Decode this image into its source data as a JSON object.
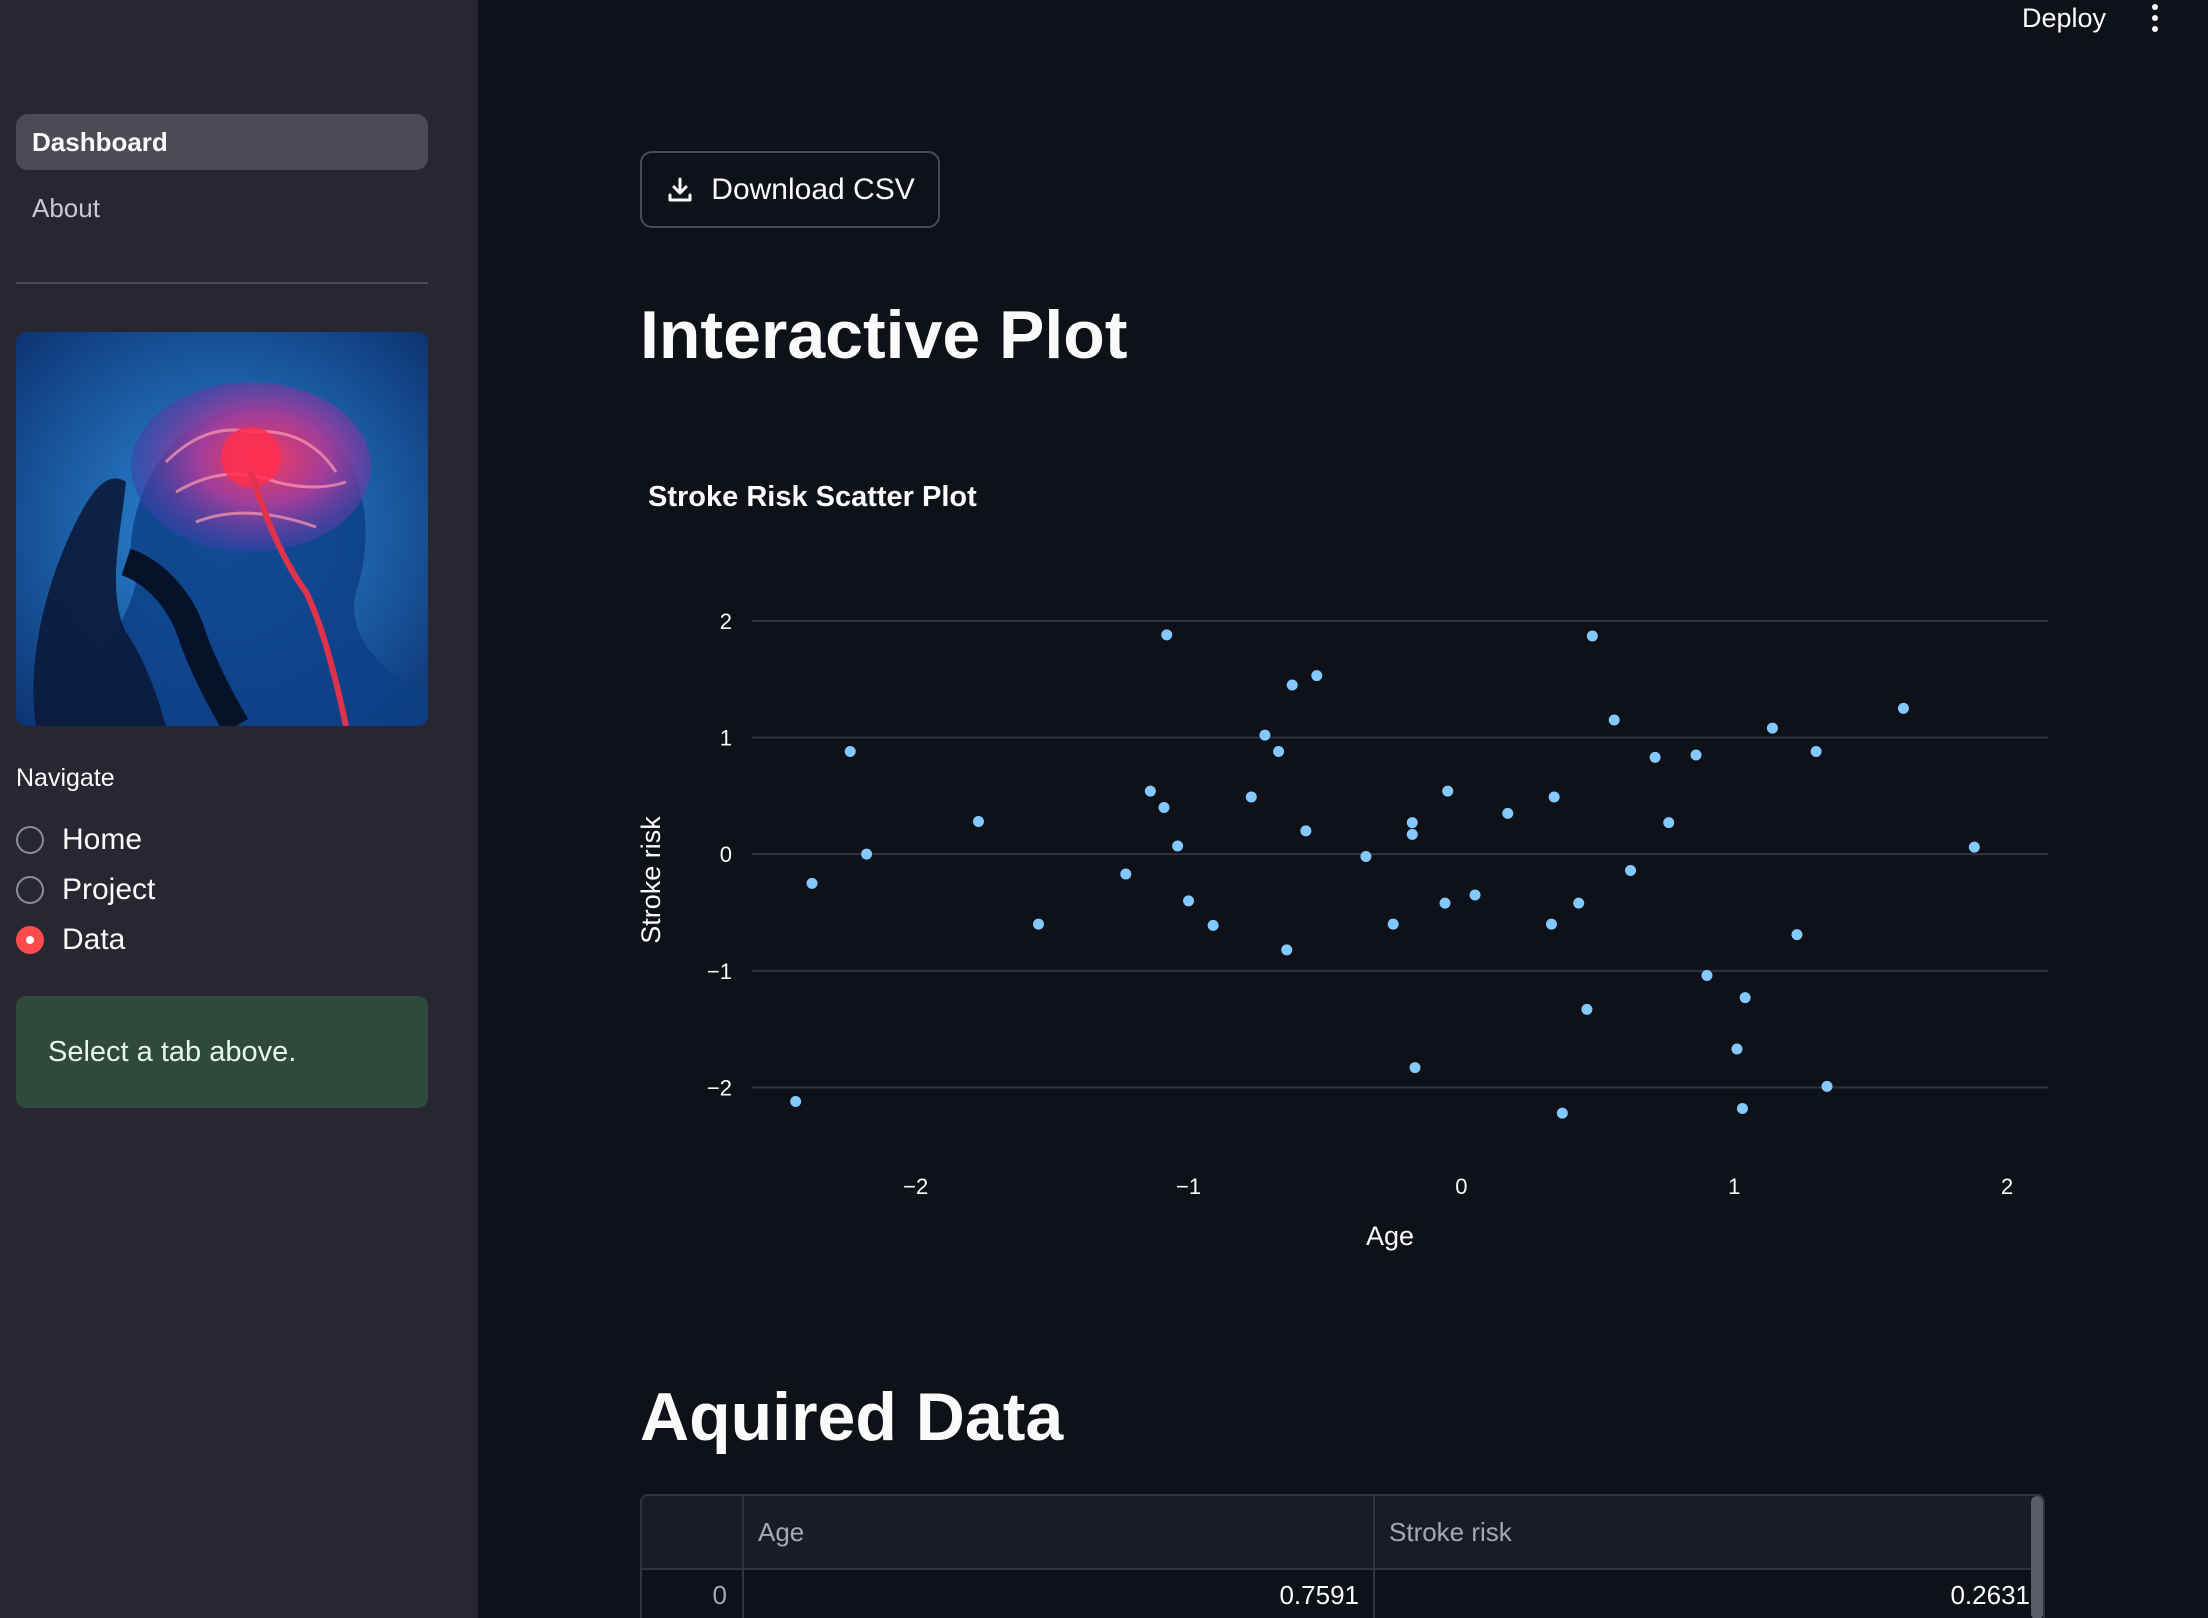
{
  "sidebar": {
    "nav": [
      {
        "label": "Dashboard",
        "active": true
      },
      {
        "label": "About",
        "active": false
      }
    ],
    "radio": {
      "label": "Navigate",
      "options": [
        {
          "label": "Home",
          "checked": false
        },
        {
          "label": "Project",
          "checked": false
        },
        {
          "label": "Data",
          "checked": true
        }
      ]
    },
    "info": "Select a tab above."
  },
  "topbar": {
    "deploy_label": "Deploy",
    "menu_icon": "kebab-menu-icon"
  },
  "main": {
    "download_label": "Download CSV",
    "download_icon": "download-icon",
    "plot_heading": "Interactive Plot",
    "data_heading": "Aquired Data"
  },
  "chart_data": {
    "type": "scatter",
    "title": "Stroke Risk Scatter Plot",
    "xlabel": "Age",
    "ylabel": "Stroke risk",
    "xlim": [
      -2.6,
      2.15
    ],
    "ylim": [
      -2.45,
      2.35
    ],
    "xticks": [
      -2,
      -1,
      0,
      1,
      2
    ],
    "yticks": [
      -2,
      -1,
      0,
      1,
      2
    ],
    "grid": "horizontal",
    "color": "#83c9ff",
    "points": [
      [
        -2.44,
        -2.12
      ],
      [
        -2.38,
        -0.25
      ],
      [
        -2.24,
        0.88
      ],
      [
        -2.18,
        0.0
      ],
      [
        -1.77,
        0.28
      ],
      [
        -1.55,
        -0.6
      ],
      [
        -1.23,
        -0.17
      ],
      [
        -1.14,
        0.54
      ],
      [
        -1.09,
        0.4
      ],
      [
        -1.08,
        1.88
      ],
      [
        -1.04,
        0.07
      ],
      [
        -1.0,
        -0.4
      ],
      [
        -0.91,
        -0.61
      ],
      [
        -0.77,
        0.49
      ],
      [
        -0.72,
        1.02
      ],
      [
        -0.67,
        0.88
      ],
      [
        -0.64,
        -0.82
      ],
      [
        -0.62,
        1.45
      ],
      [
        -0.57,
        0.2
      ],
      [
        -0.53,
        1.53
      ],
      [
        -0.35,
        -0.02
      ],
      [
        -0.25,
        -0.6
      ],
      [
        -0.18,
        0.27
      ],
      [
        -0.18,
        0.17
      ],
      [
        -0.17,
        -1.83
      ],
      [
        -0.06,
        -0.42
      ],
      [
        -0.05,
        0.54
      ],
      [
        0.05,
        -0.35
      ],
      [
        0.17,
        0.35
      ],
      [
        0.33,
        -0.6
      ],
      [
        0.34,
        0.49
      ],
      [
        0.37,
        -2.22
      ],
      [
        0.43,
        -0.42
      ],
      [
        0.46,
        -1.33
      ],
      [
        0.48,
        1.87
      ],
      [
        0.56,
        1.15
      ],
      [
        0.62,
        -0.14
      ],
      [
        0.71,
        0.83
      ],
      [
        0.76,
        0.27
      ],
      [
        0.86,
        0.85
      ],
      [
        0.9,
        -1.04
      ],
      [
        1.01,
        -1.67
      ],
      [
        1.03,
        -2.18
      ],
      [
        1.04,
        -1.23
      ],
      [
        1.14,
        1.08
      ],
      [
        1.23,
        -0.69
      ],
      [
        1.3,
        0.88
      ],
      [
        1.34,
        -1.99
      ],
      [
        1.62,
        1.25
      ],
      [
        1.88,
        0.06
      ]
    ]
  },
  "table": {
    "columns": [
      "Age",
      "Stroke risk"
    ],
    "rows": [
      {
        "index": "0",
        "values": [
          "0.7591",
          "0.2631"
        ]
      }
    ]
  }
}
